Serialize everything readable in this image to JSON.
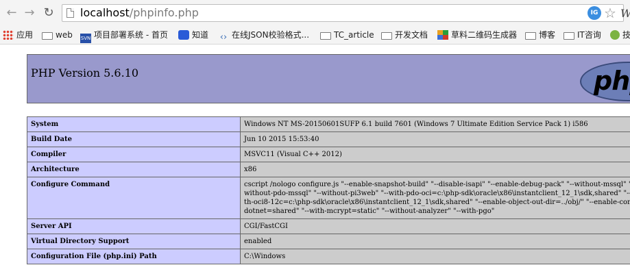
{
  "browser": {
    "url_host": "localhost",
    "url_path": "/phpinfo.php",
    "extension_label": "IG",
    "extension2_label": "W",
    "bookmarks": [
      {
        "label": "应用",
        "icon": "apps-grid-icon"
      },
      {
        "label": "web",
        "icon": "folder-icon"
      },
      {
        "label": "项目部署系统 - 首页",
        "icon": "site-icon"
      },
      {
        "label": "知道",
        "icon": "paw-icon"
      },
      {
        "label": "在线JSON校验格式...",
        "icon": "code-icon"
      },
      {
        "label": "TC_article",
        "icon": "folder-icon"
      },
      {
        "label": "开发文档",
        "icon": "folder-icon"
      },
      {
        "label": "草料二维码生成器",
        "icon": "qr-icon"
      },
      {
        "label": "博客",
        "icon": "folder-icon"
      },
      {
        "label": "IT咨询",
        "icon": "folder-icon"
      },
      {
        "label": "技",
        "icon": "globe-icon"
      }
    ]
  },
  "php": {
    "version_title": "PHP Version 5.6.10",
    "logo_text": "php",
    "rows": [
      {
        "key": "System",
        "value": "Windows NT MS-20150601SUFP 6.1 build 7601 (Windows 7 Ultimate Edition Service Pack 1) i586"
      },
      {
        "key": "Build Date",
        "value": "Jun 10 2015 15:53:40"
      },
      {
        "key": "Compiler",
        "value": "MSVC11 (Visual C++ 2012)"
      },
      {
        "key": "Architecture",
        "value": "x86"
      },
      {
        "key": "Configure Command",
        "value": "cscript /nologo configure.js \"--enable-snapshot-build\" \"--disable-isapi\" \"--enable-debug-pack\" \"--without-mssql\" \"--without-pdo-mssql\" \"--without-pi3web\" \"--with-pdo-oci=c:\\php-sdk\\oracle\\x86\\instantclient_12_1\\sdk,shared\" \"--with-oci8-12c=c:\\php-sdk\\oracle\\x86\\instantclient_12_1\\sdk,shared\" \"--enable-object-out-dir=../obj/\" \"--enable-com-dotnet=shared\" \"--with-mcrypt=static\" \"--without-analyzer\" \"--with-pgo\""
      },
      {
        "key": "Server API",
        "value": "CGI/FastCGI"
      },
      {
        "key": "Virtual Directory Support",
        "value": "enabled"
      },
      {
        "key": "Configuration File (php.ini) Path",
        "value": "C:\\Windows"
      }
    ]
  }
}
